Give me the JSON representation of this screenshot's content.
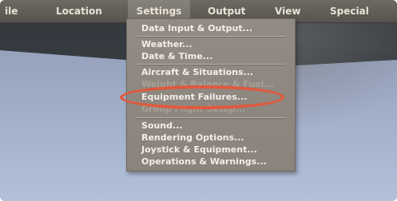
{
  "menubar": {
    "items": [
      {
        "label": "ile",
        "active": false
      },
      {
        "label": "Location",
        "active": false
      },
      {
        "label": "Settings",
        "active": true
      },
      {
        "label": "Output",
        "active": false
      },
      {
        "label": "View",
        "active": false
      },
      {
        "label": "Special",
        "active": false
      }
    ]
  },
  "settings_menu": {
    "items": [
      {
        "label": "Data Input & Output...",
        "enabled": true
      },
      {
        "label": "Weather...",
        "enabled": true
      },
      {
        "label": "Date & Time...",
        "enabled": true
      },
      {
        "label": "Aircraft & Situations...",
        "enabled": true
      },
      {
        "label": "Weight & Balance & Fuel...",
        "enabled": false
      },
      {
        "label": "Equipment Failures...",
        "enabled": true,
        "highlighted": true
      },
      {
        "label": "Group Flight Setup...",
        "enabled": false
      },
      {
        "label": "Sound...",
        "enabled": true
      },
      {
        "label": "Rendering Options...",
        "enabled": true
      },
      {
        "label": "Joystick & Equipment...",
        "enabled": true
      },
      {
        "label": "Operations & Warnings...",
        "enabled": true
      }
    ]
  },
  "colors": {
    "menubar_bg": "#5f5b55",
    "menu_bg": "#8d877f",
    "menu_text": "#f3efe6",
    "highlight_ring": "#e0593d"
  }
}
